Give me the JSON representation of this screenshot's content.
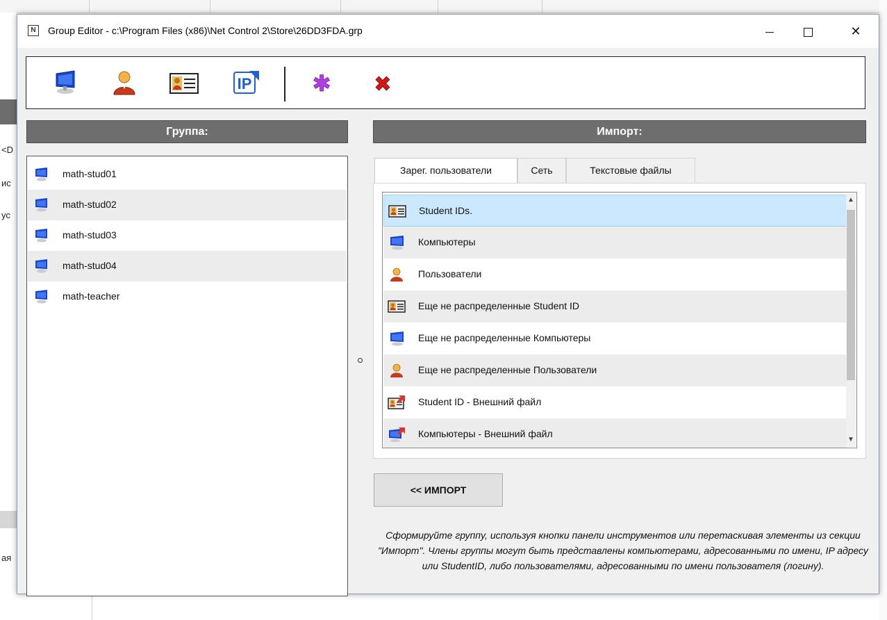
{
  "background": {
    "left_fragments": [
      "<D",
      "ис",
      "ус",
      "ая"
    ]
  },
  "window": {
    "title": "Group Editor - c:\\Program Files (x86)\\Net Control 2\\Store\\26DD3FDA.grp",
    "app_icon_glyph": "N",
    "controls": {
      "close": "✕"
    }
  },
  "toolbar": {
    "items": [
      {
        "name": "add-computer",
        "icon": "monitor-icon"
      },
      {
        "name": "add-user",
        "icon": "user-icon"
      },
      {
        "name": "add-student-id",
        "icon": "id-card-icon"
      },
      {
        "name": "add-ip",
        "icon": "ip-icon",
        "glyph": "IP"
      },
      {
        "name": "wildcard",
        "icon": "asterisk-icon",
        "glyph": "✱"
      },
      {
        "name": "delete",
        "icon": "delete-icon",
        "glyph": "✖"
      }
    ]
  },
  "group": {
    "header": "Группа:",
    "items": [
      "math-stud01",
      "math-stud02",
      "math-stud03",
      "math-stud04",
      "math-teacher"
    ]
  },
  "import": {
    "header": "Импорт:",
    "tabs": [
      "Зарег. пользователи",
      "Сеть",
      "Текстовые файлы"
    ],
    "active_tab": "Зарег. пользователи",
    "items": [
      {
        "label": "Student IDs.",
        "icon": "id-card-icon",
        "selected": true
      },
      {
        "label": "Компьютеры",
        "icon": "monitor-icon"
      },
      {
        "label": "Пользователи",
        "icon": "user-icon"
      },
      {
        "label": "Еще не распределенные Student ID",
        "icon": "id-card-icon"
      },
      {
        "label": "Еще не распределенные Компьютеры",
        "icon": "monitor-icon"
      },
      {
        "label": "Еще не распределенные Пользователи",
        "icon": "user-icon"
      },
      {
        "label": "Student ID - Внешний файл",
        "icon": "id-card-external-icon"
      },
      {
        "label": "Компьютеры - Внешний файл",
        "icon": "monitor-external-icon"
      }
    ],
    "button": "<< ИМПОРТ",
    "hint": "Сформируйте группу, используя кнопки панели инструментов или перетаскивая элементы из секции \"Импорт\". Члены группы могут быть представлены компьютерами, адресованными по имени, IP адресу или StudentID, либо пользователями, адресованными по имени пользователя (логину)."
  },
  "colors": {
    "header_bg": "#6e6e6e",
    "selection_bg": "#cce8ff",
    "monitor_blue": "#1a45c8",
    "user_orange": "#e07a1a",
    "asterisk_purple": "#b040e0",
    "delete_red": "#d01818",
    "ip_blue": "#1f5fd0"
  }
}
